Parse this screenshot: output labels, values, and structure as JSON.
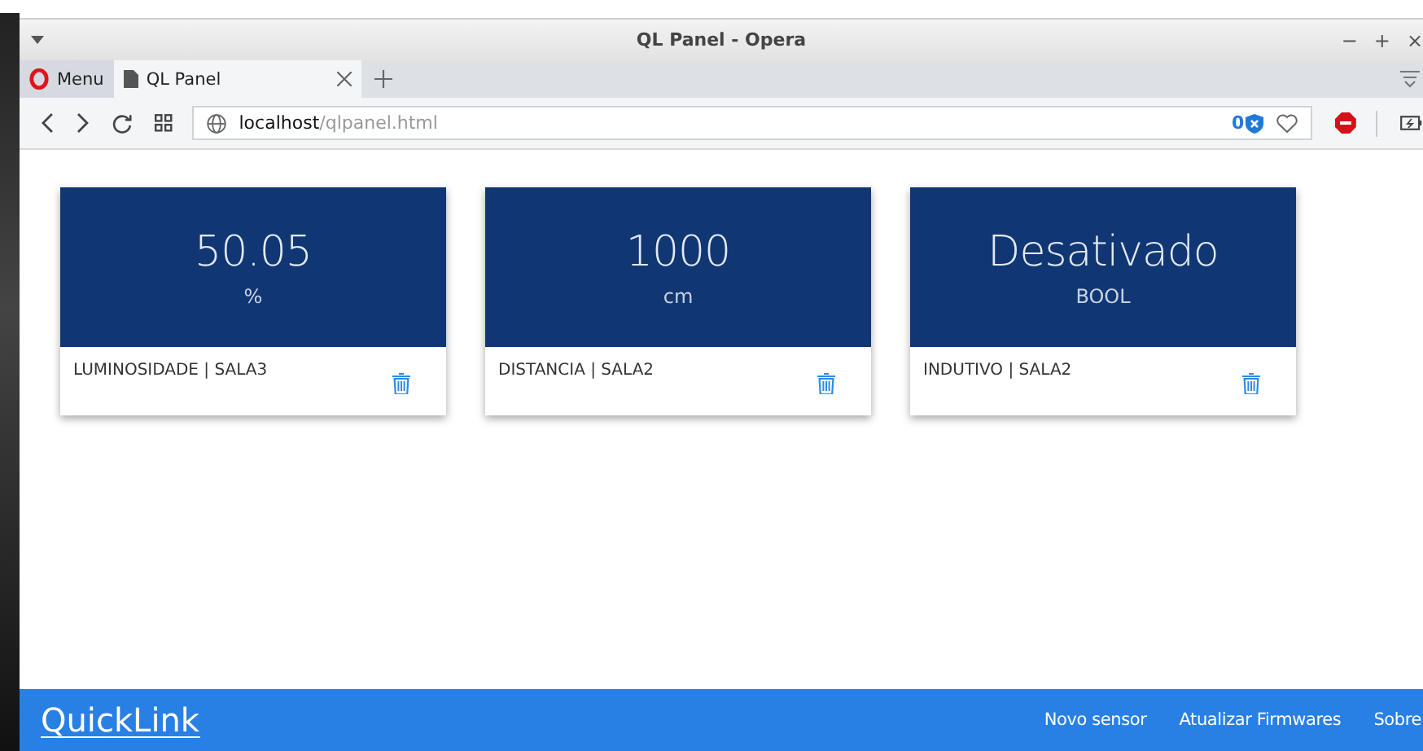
{
  "window": {
    "title": "QL Panel - Opera",
    "controls": [
      "−",
      "+",
      "×"
    ]
  },
  "tabs": [
    {
      "label": "Menu",
      "kind": "menu",
      "selected": false
    },
    {
      "label": "QL Panel",
      "kind": "page",
      "selected": true
    }
  ],
  "address": {
    "host": "localhost",
    "path": "/qlpanel.html",
    "blocked_count": "0"
  },
  "cards": [
    {
      "value": "50.05",
      "unit": "%",
      "label": "LUMINOSIDADE | SALA3"
    },
    {
      "value": "1000",
      "unit": "cm",
      "label": "DISTANCIA | SALA2"
    },
    {
      "value": "Desativado",
      "unit": "BOOL",
      "label": "INDUTIVO | SALA2"
    }
  ],
  "footer": {
    "brand": "QuickLink",
    "links": [
      "Novo sensor",
      "Atualizar Firmwares",
      "Sobre"
    ]
  }
}
